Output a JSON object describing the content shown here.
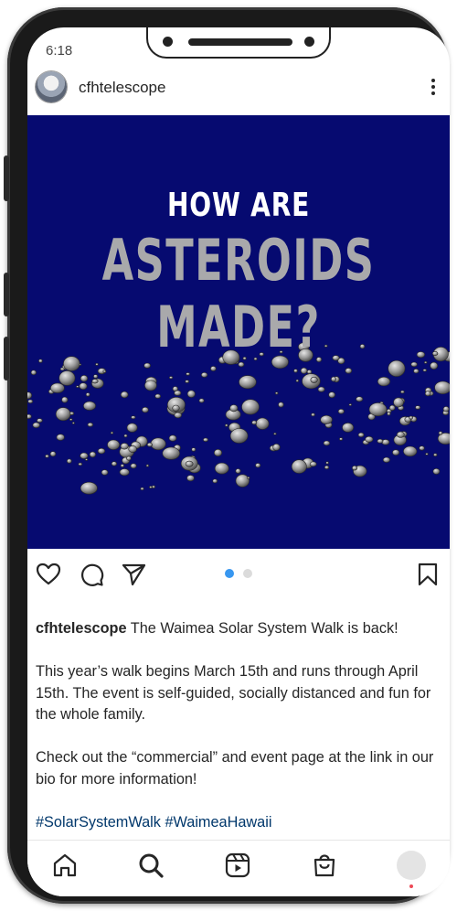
{
  "status_bar": {
    "time": "6:18"
  },
  "post": {
    "username": "cfhtelescope",
    "image_title_line1": "HOW ARE",
    "image_title_line2": "ASTEROIDS MADE?",
    "carousel": {
      "count": 2,
      "active_index": 0
    }
  },
  "caption": {
    "username": "cfhtelescope",
    "intro": "The Waimea Solar System Walk is back!",
    "paragraph2": "This year’s walk begins March 15th and runs through April 15th.  The event is self-guided, socially distanced and fun for the whole family.",
    "paragraph3": "Check out the “commercial” and event page at the link in our bio for more information!",
    "hashtags": "#SolarSystemWalk #WaimeaHawaii"
  },
  "icons": {
    "like": "heart-icon",
    "comment": "comment-icon",
    "share": "share-icon",
    "save": "bookmark-icon",
    "home": "home-icon",
    "search": "search-icon",
    "reels": "reels-icon",
    "shop": "shop-icon",
    "profile": "profile-avatar"
  },
  "colors": {
    "image_background": "#060a70",
    "carousel_active": "#3897f0",
    "carousel_inactive": "#dbdbdb",
    "hashtag": "#00376b",
    "notification": "#ed4956"
  }
}
